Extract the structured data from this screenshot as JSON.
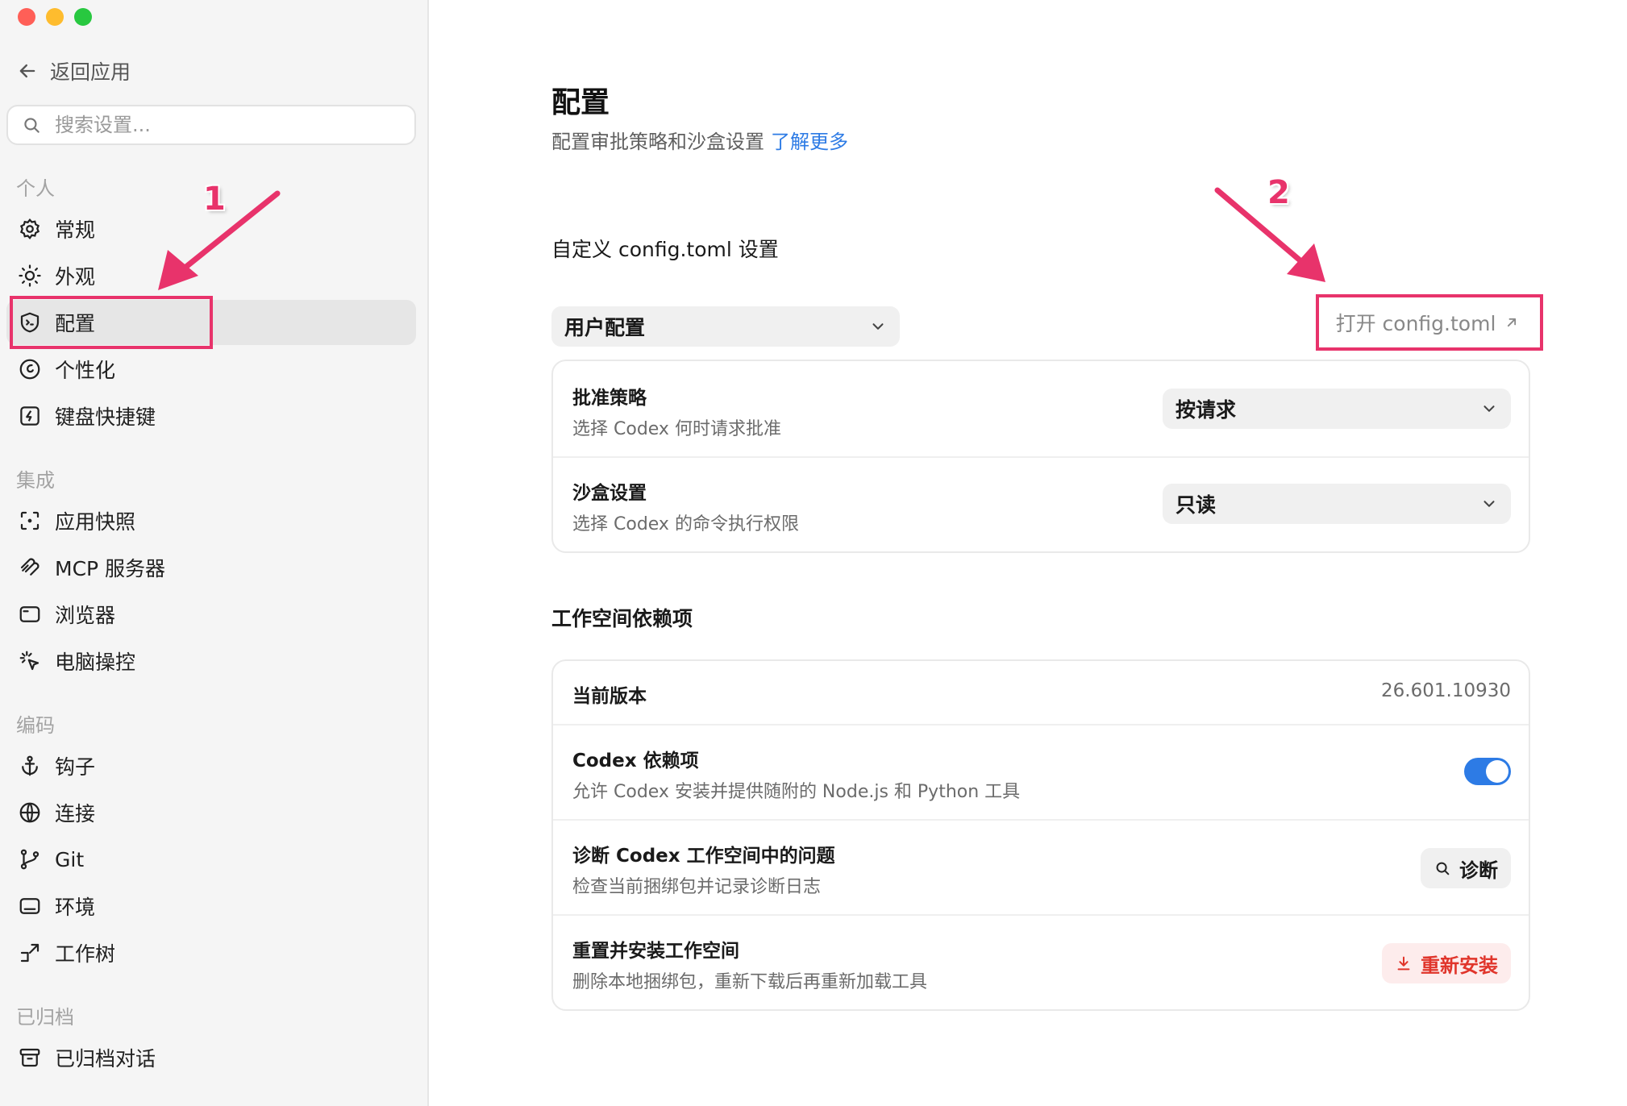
{
  "sidebar": {
    "back_label": "返回应用",
    "search_placeholder": "搜索设置...",
    "sections": {
      "personal": "个人",
      "integrations": "集成",
      "coding": "编码",
      "archived": "已归档"
    },
    "items": {
      "general": "常规",
      "appearance": "外观",
      "config": "配置",
      "personalization": "个性化",
      "shortcuts": "键盘快捷键",
      "app_snapshot": "应用快照",
      "mcp": "MCP 服务器",
      "browser": "浏览器",
      "computer_control": "电脑操控",
      "hooks": "钩子",
      "connections": "连接",
      "git": "Git",
      "environment": "环境",
      "worktree": "工作树",
      "archived_chats": "已归档对话"
    }
  },
  "main": {
    "title": "配置",
    "subtitle": "配置审批策略和沙盒设置",
    "learn_more": "了解更多",
    "config_section_title": "自定义 config.toml 设置",
    "profile_select_value": "用户配置",
    "open_config_label": "打开 config.toml",
    "approval": {
      "title": "批准策略",
      "desc": "选择 Codex 何时请求批准",
      "value": "按请求"
    },
    "sandbox": {
      "title": "沙盒设置",
      "desc": "选择 Codex 的命令执行权限",
      "value": "只读"
    },
    "workspace_section_title": "工作空间依赖项",
    "version": {
      "title": "当前版本",
      "value": "26.601.10930"
    },
    "dependencies": {
      "title": "Codex 依赖项",
      "desc": "允许 Codex 安装并提供随附的 Node.js 和 Python 工具",
      "enabled": true
    },
    "diagnose": {
      "title": "诊断 Codex 工作空间中的问题",
      "desc": "检查当前捆绑包并记录诊断日志",
      "button": "诊断"
    },
    "reset": {
      "title": "重置并安装工作空间",
      "desc": "删除本地捆绑包，重新下载后再重新加载工具",
      "button": "重新安装"
    }
  },
  "annotations": {
    "marker1": "1",
    "marker2": "2",
    "color": "#e8336b"
  },
  "colors": {
    "accent": "#2d7be5",
    "danger": "#e0352b"
  }
}
